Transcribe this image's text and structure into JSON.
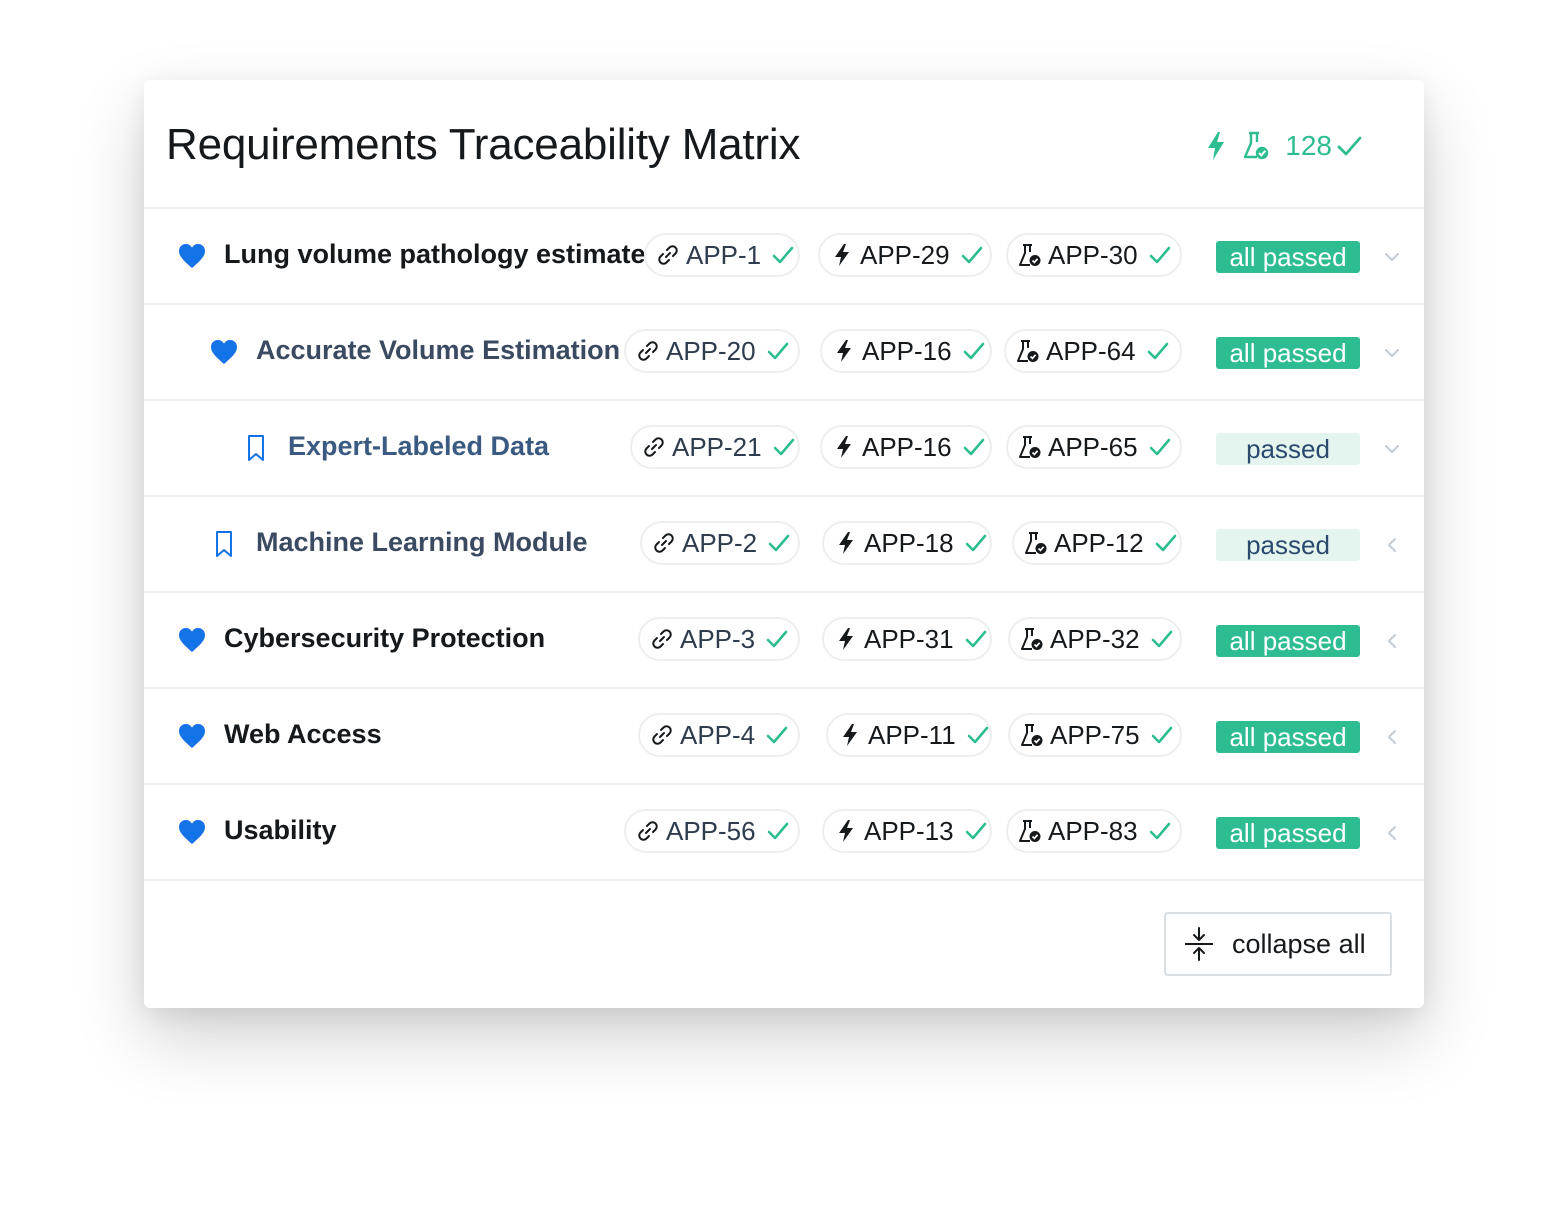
{
  "title": "Requirements Traceability Matrix",
  "summary": {
    "count": "128",
    "icons": [
      "bolt-icon",
      "flask-check-icon",
      "check-icon"
    ],
    "color": "#2ebd92"
  },
  "colors": {
    "accent_green": "#2ebd92",
    "heart_blue": "#1473e6",
    "status_partial_bg": "#e4f5ef"
  },
  "rows": [
    {
      "label": "Lung volume pathology estimates",
      "icon": "heart-icon",
      "level": 0,
      "links": [
        "APP-1",
        "APP-29",
        "APP-30"
      ],
      "status": "all passed",
      "toggle": "chevron-down-icon"
    },
    {
      "label": "Accurate Volume Estimation",
      "icon": "heart-icon",
      "level": 1,
      "links": [
        "APP-20",
        "APP-16",
        "APP-64"
      ],
      "status": "all passed",
      "toggle": "chevron-down-icon"
    },
    {
      "label": "Expert-Labeled Data",
      "icon": "bookmark-icon",
      "level": 2,
      "links": [
        "APP-21",
        "APP-16",
        "APP-65"
      ],
      "status": "passed",
      "toggle": "chevron-down-icon"
    },
    {
      "label": "Machine Learning Module",
      "icon": "bookmark-icon",
      "level": 1,
      "links": [
        "APP-2",
        "APP-18",
        "APP-12"
      ],
      "status": "passed",
      "toggle": "chevron-left-icon"
    },
    {
      "label": "Cybersecurity Protection",
      "icon": "heart-icon",
      "level": 0,
      "links": [
        "APP-3",
        "APP-31",
        "APP-32"
      ],
      "status": "all passed",
      "toggle": "chevron-left-icon"
    },
    {
      "label": "Web Access",
      "icon": "heart-icon",
      "level": 0,
      "links": [
        "APP-4",
        "APP-11",
        "APP-75"
      ],
      "status": "all passed",
      "toggle": "chevron-left-icon"
    },
    {
      "label": "Usability",
      "icon": "heart-icon",
      "level": 0,
      "links": [
        "APP-56",
        "APP-13",
        "APP-83"
      ],
      "status": "all passed",
      "toggle": "chevron-left-icon"
    }
  ],
  "collapse_button": {
    "label": "collapse all",
    "icon": "collapse-vertical-icon"
  }
}
